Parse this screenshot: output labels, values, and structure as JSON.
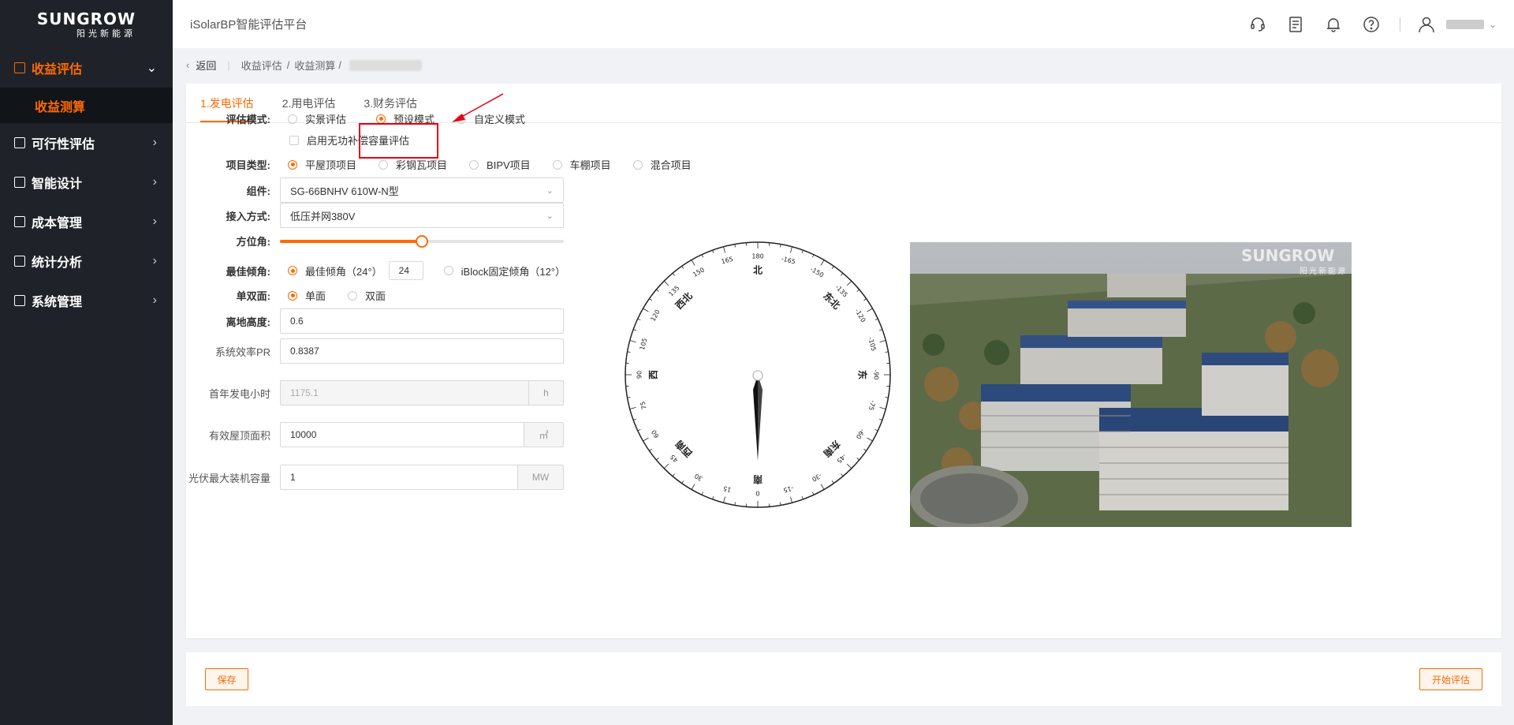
{
  "brand": {
    "logo_text": "SUNGROW",
    "logo_sub": "阳光新能源",
    "accent": "#ff6a00"
  },
  "header": {
    "title": "iSolarBP智能评估平台"
  },
  "sidebar": {
    "items": [
      {
        "label": "收益评估",
        "icon": "receipt-icon",
        "active": true,
        "expanded": true
      },
      {
        "label": "可行性评估",
        "icon": "chart-box-icon"
      },
      {
        "label": "智能设计",
        "icon": "design-icon"
      },
      {
        "label": "成本管理",
        "icon": "calculator-icon"
      },
      {
        "label": "统计分析",
        "icon": "stats-icon"
      },
      {
        "label": "系统管理",
        "icon": "settings-box-icon"
      }
    ],
    "submenu": {
      "label": "收益测算"
    }
  },
  "breadcrumb": {
    "back": "返回",
    "level1": "收益评估",
    "level2": "收益测算"
  },
  "tabs": [
    {
      "label": "1.发电评估",
      "active": true
    },
    {
      "label": "2.用电评估"
    },
    {
      "label": "3.财务评估"
    }
  ],
  "form": {
    "eval_mode": {
      "label": "评估模式:",
      "options": [
        "实景评估",
        "预设模式",
        "自定义模式"
      ],
      "selected": "预设模式",
      "checkbox": "启用无功补偿容量评估"
    },
    "project_type": {
      "label": "项目类型:",
      "options": [
        "平屋顶项目",
        "彩钢瓦项目",
        "BIPV项目",
        "车棚项目",
        "混合项目"
      ],
      "selected": "平屋顶项目"
    },
    "module": {
      "label": "组件:",
      "value": "SG-66BNHV 610W-N型"
    },
    "access": {
      "label": "接入方式:",
      "value": "低压并网380V"
    },
    "azimuth": {
      "label": "方位角:",
      "level_percent": 50
    },
    "tilt": {
      "label": "最佳倾角:",
      "opt1": "最佳倾角（24°）",
      "value": "24",
      "opt2": "iBlock固定倾角（12°）"
    },
    "face": {
      "label": "单双面:",
      "options": [
        "单面",
        "双面"
      ],
      "selected": "单面"
    },
    "height": {
      "label": "离地高度:",
      "value": "0.6"
    },
    "pr": {
      "label": "系统效率PR",
      "value": "0.8387"
    },
    "first_year": {
      "label": "首年发电小时",
      "value": "1175.1",
      "unit": "h"
    },
    "roof_area": {
      "label": "有效屋顶面积",
      "value": "10000",
      "unit": "㎡"
    },
    "max_capacity": {
      "label": "光伏最大装机容量",
      "value": "1",
      "unit": "MW"
    }
  },
  "compass": {
    "dirs": {
      "n": "北",
      "s": "南",
      "e": "东",
      "w": "西",
      "ne": "东北",
      "nw": "西北",
      "se": "东南",
      "sw": "西南"
    },
    "ticks": [
      "180",
      "-165",
      "-150",
      "-135",
      "-120",
      "-105",
      "-90",
      "-75",
      "-60",
      "-45",
      "-30",
      "-15",
      "0",
      "15",
      "30",
      "45",
      "60",
      "75",
      "90",
      "105",
      "120",
      "135",
      "150",
      "165"
    ]
  },
  "photo_watermark": {
    "text": "SUNGROW",
    "sub": "阳光新能源"
  },
  "footer": {
    "save": "保存",
    "start": "开始评估"
  }
}
